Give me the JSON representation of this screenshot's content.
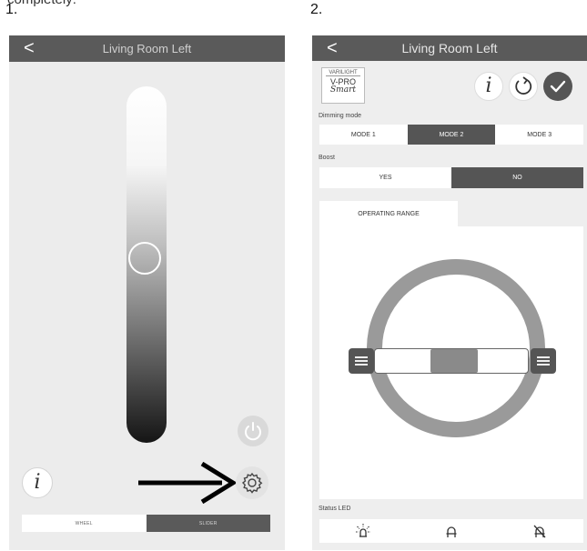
{
  "captions": {
    "partial": "completely:",
    "first": "1.",
    "second": "2."
  },
  "screen1": {
    "back_glyph": "<",
    "title": "Living Room Left",
    "slider_value": 0.52,
    "info_glyph": "i",
    "segments": [
      {
        "label": "WHEEL",
        "active": false
      },
      {
        "label": "SLIDER",
        "active": true
      }
    ],
    "icons": [
      "back-icon",
      "power-icon",
      "info-icon",
      "arrow-right-icon",
      "gear-icon"
    ]
  },
  "screen2": {
    "back_glyph": "<",
    "title": "Living Room Left",
    "logo": {
      "brand": "VARILIGHT",
      "product": "V-PRO",
      "sub": "Smart"
    },
    "info_glyph": "i",
    "dimming_label": "Dimming mode",
    "modes": [
      {
        "label": "MODE 1",
        "active": false
      },
      {
        "label": "MODE 2",
        "active": true
      },
      {
        "label": "MODE 3",
        "active": false
      }
    ],
    "boost_label": "Boost",
    "boost": [
      {
        "label": "YES",
        "active": false
      },
      {
        "label": "NO",
        "active": true
      }
    ],
    "tab_label": "OPERATING RANGE",
    "status_led_label": "Status LED",
    "icons": [
      "back-icon",
      "info-icon",
      "refresh-icon",
      "check-icon",
      "bulb-on-icon",
      "bulb-icon",
      "bulb-off-icon"
    ],
    "colors": {
      "header": "#5a5a5a",
      "active": "#555555",
      "ring": "#9a9a9a"
    }
  }
}
